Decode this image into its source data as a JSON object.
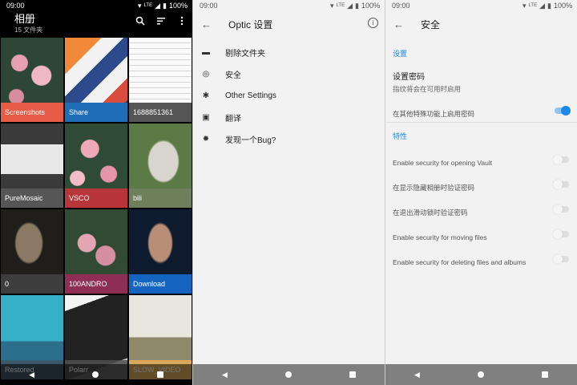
{
  "status": {
    "time": "09:00",
    "network": "LTE",
    "battery": "100%"
  },
  "gallery": {
    "title": "相册",
    "subtitle": "15 文件夹",
    "albums": [
      {
        "label": "Screenshots",
        "color": "#e85c47"
      },
      {
        "label": "Share",
        "color": "#1e6eb5"
      },
      {
        "label": "1688851361",
        "color": "#555555"
      },
      {
        "label": "PureMosaic",
        "color": "#565656"
      },
      {
        "label": "VSCO",
        "color": "#b8363a"
      },
      {
        "label": "bili",
        "color": "#6e7f5c"
      },
      {
        "label": "0",
        "color": "#3e3e3e"
      },
      {
        "label": "100ANDRO",
        "color": "#8e2e55"
      },
      {
        "label": "Download",
        "color": "#1565c0"
      },
      {
        "label": "Restored",
        "color": "#3c5564"
      },
      {
        "label": "Polarr",
        "color": "#555555"
      },
      {
        "label": "SLOW_VIDEO",
        "color": "#d8a85a"
      }
    ]
  },
  "optic": {
    "title": "Optic 设置",
    "items": [
      {
        "label": "剔除文件夹",
        "icon": "folder-remove-icon"
      },
      {
        "label": "安全",
        "icon": "fingerprint-icon"
      },
      {
        "label": "Other Settings",
        "icon": "gear-icon"
      },
      {
        "label": "翻译",
        "icon": "translate-icon"
      },
      {
        "label": "发现一个Bug?",
        "icon": "bug-icon"
      }
    ]
  },
  "security": {
    "title": "安全",
    "section_settings": "设置",
    "password_title": "设置密码",
    "password_summary": "指纹将会在可用时启用",
    "password_special_label": "在其他特殊功能上启用密码",
    "password_special_on": true,
    "section_features": "特性",
    "features": [
      {
        "label": "Enable security for opening Vault",
        "on": false
      },
      {
        "label": "在显示隐藏相册时验证密码",
        "on": false
      },
      {
        "label": "在退出滑动锁时验证密码",
        "on": false
      },
      {
        "label": "Enable security for moving files",
        "on": false
      },
      {
        "label": "Enable security for deleting files and albums",
        "on": false
      }
    ]
  },
  "colors": {
    "accent": "#1e88e5",
    "settings_bg": "#f2f2f2",
    "nav_bar": "#808080"
  }
}
